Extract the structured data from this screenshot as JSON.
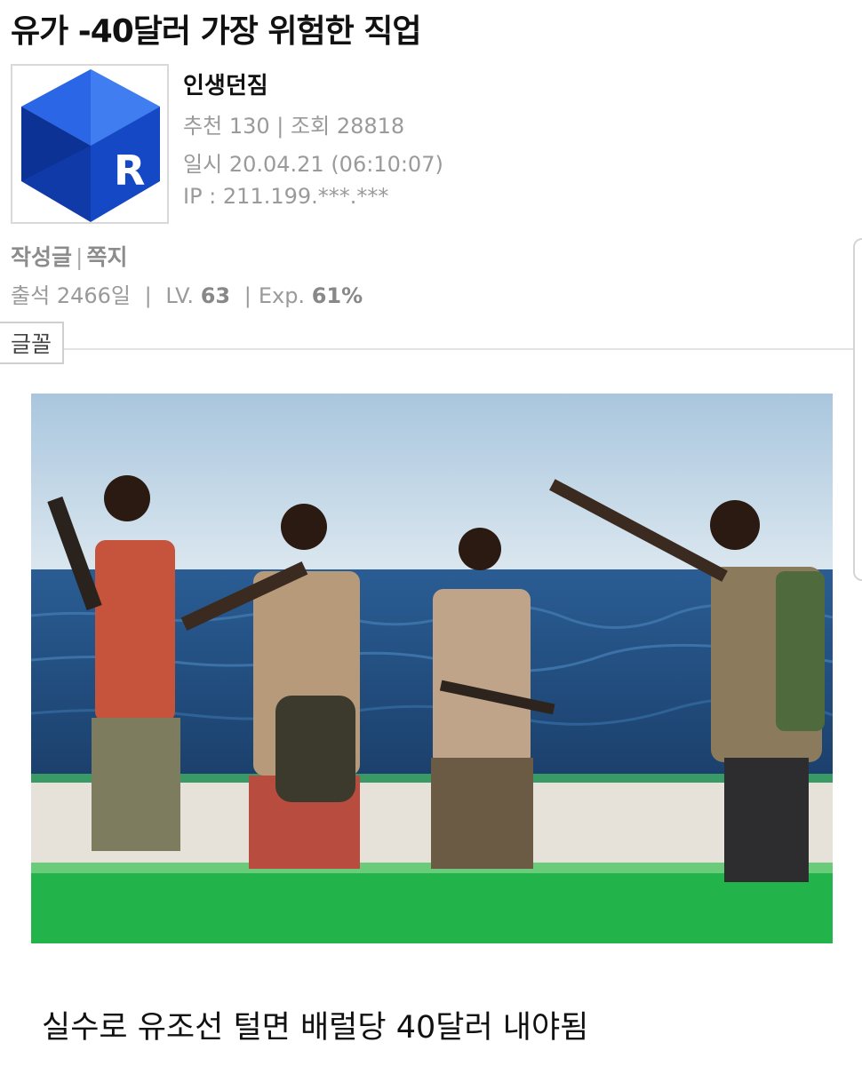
{
  "post": {
    "title": "유가 -40달러 가장 위험한 직업",
    "caption": "실수로 유조선 털면 배럴당 40달러 내야됨"
  },
  "author": {
    "avatar_icon": "blue-cube-r-logo-icon",
    "avatar_letter": "R",
    "name": "인생던짐",
    "recommend_label": "추천",
    "recommend_count": "130",
    "views_label": "조회",
    "views_count": "28818",
    "date_label": "일시",
    "date_value": "20.04.21 (06:10:07)",
    "ip_label": "IP :",
    "ip_value": "211.199.***.***",
    "link_posts": "작성글",
    "link_message": "쪽지",
    "attendance_label": "출석",
    "attendance_value": "2466일",
    "level_label": "LV.",
    "level_value": "63",
    "exp_label": "Exp.",
    "exp_value": "61%"
  },
  "toolbar": {
    "font_button": "글꼴"
  },
  "colors": {
    "logo_blue": "#1444c8",
    "muted_text": "#9a9a9a",
    "boat_green": "#25b84a",
    "sea": "#234c7a",
    "sky": "#c9dcea"
  }
}
